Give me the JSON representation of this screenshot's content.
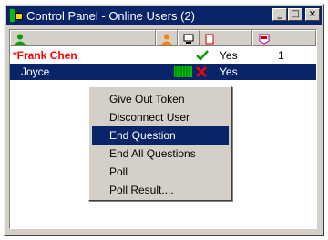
{
  "window": {
    "title": "Control Panel - Online Users (2)",
    "buttons": {
      "minimize": "_",
      "maximize": "□",
      "close": "×"
    }
  },
  "table": {
    "columns": [
      {
        "icon": "user-icon"
      },
      {
        "icon": "user-orange-icon"
      },
      {
        "icon": "monitor-icon"
      },
      {
        "icon": "document-icon"
      },
      {
        "icon": "question-badge-icon"
      }
    ],
    "rows": [
      {
        "name": "*Frank Chen",
        "status": "check",
        "flag": "Yes",
        "count": "1"
      },
      {
        "name": "Joyce",
        "status": "x",
        "flag": "Yes",
        "count": ""
      }
    ]
  },
  "context_menu": {
    "items": [
      {
        "label": "Give Out Token"
      },
      {
        "label": "Disconnect User"
      },
      {
        "label": "End Question"
      },
      {
        "label": "End All Questions"
      },
      {
        "label": "Poll"
      },
      {
        "label": "Poll Result...."
      }
    ],
    "highlighted_index": 2
  },
  "colors": {
    "title_bar": "#0a246a",
    "selected_row": "#0a246a",
    "presenter_name": "#ff0000",
    "check": "#00a000",
    "x_mark": "#ff0000"
  }
}
